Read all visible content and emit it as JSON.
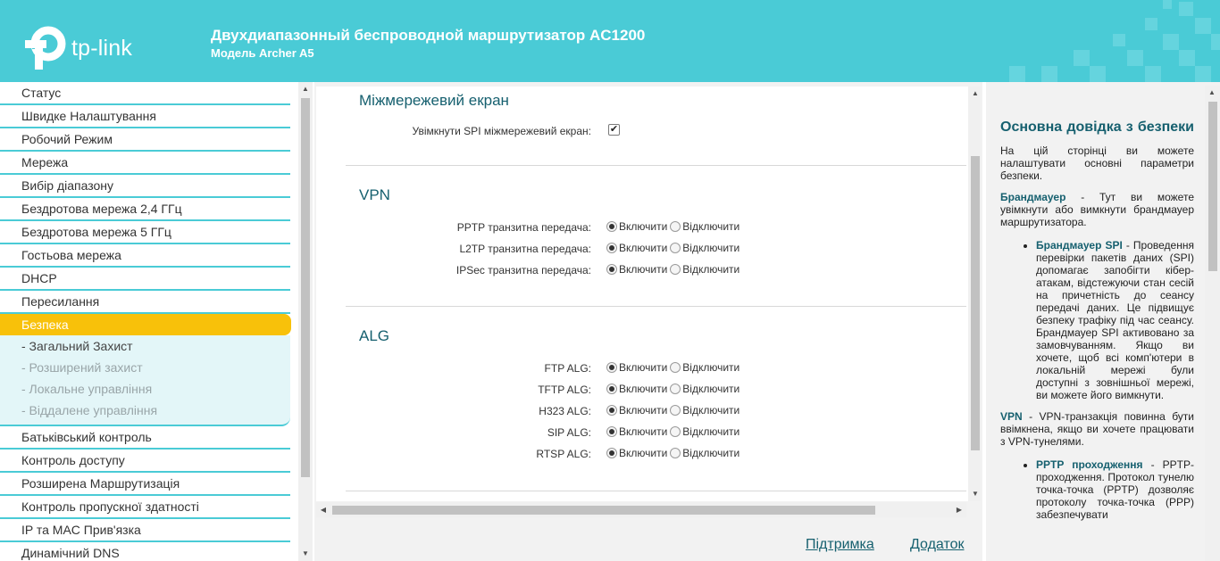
{
  "header": {
    "logo_text": "tp-link",
    "title": "Двухдиапазонный беспроводной маршрутизатор AC1200",
    "model": "Модель Archer A5"
  },
  "nav": {
    "items_top": [
      "Статус",
      "Швидке Налаштування",
      "Робочий Режим",
      "Мережа",
      "Вибір діапазону",
      "Бездротова мережа 2,4 ГГц",
      "Бездротова мережа 5 ГГц",
      "Гостьова мережа",
      "DHCP",
      "Пересилання"
    ],
    "active": "Безпека",
    "sub_items": [
      "- Загальний Захист",
      "- Розширений захист",
      "- Локальне управління",
      "- Віддалене управління"
    ],
    "items_bottom": [
      "Батьківський контроль",
      "Контроль доступу",
      "Розширена Маршрутизація",
      "Контроль пропускної здатності",
      "IP та MAC Прив'язка",
      "Динамічний DNS"
    ]
  },
  "firewall": {
    "title": "Міжмережевий екран",
    "spi_label": "Увімкнути SPI міжмережевий екран:",
    "spi_checked": true,
    "check_glyph": "✔"
  },
  "options": {
    "enable": "Включити",
    "disable": "Відключити"
  },
  "vpn": {
    "title": "VPN",
    "rows": [
      {
        "label": "PPTP транзитна передача:",
        "value": "enable"
      },
      {
        "label": "L2TP транзитна передача:",
        "value": "enable"
      },
      {
        "label": "IPSec транзитна передача:",
        "value": "enable"
      }
    ]
  },
  "alg": {
    "title": "ALG",
    "rows": [
      {
        "label": "FTP ALG:",
        "value": "enable"
      },
      {
        "label": "TFTP ALG:",
        "value": "enable"
      },
      {
        "label": "H323 ALG:",
        "value": "enable"
      },
      {
        "label": "SIP ALG:",
        "value": "enable"
      },
      {
        "label": "RTSP ALG:",
        "value": "enable"
      }
    ]
  },
  "footer": {
    "support": "Підтримка",
    "addendum": "Додаток"
  },
  "help": {
    "title": "Основна довідка з безпеки",
    "intro": "На цій сторінці ви можете налаштувати основні параметри безпеки.",
    "firewall_term": "Брандмауер",
    "firewall_text": " - Тут ви можете увімкнути або вимкнути брандмауер маршрутизатора.",
    "spi_term": "Брандмауер SPI",
    "spi_text": " - Проведення перевірки пакетів даних (SPI) допомагає запобігти кібер-атакам, відстежуючи стан сесій на причетність до сеансу передачі даних. Це підвищує безпеку трафіку під час сеансу. Брандмауер SPI активовано за замовчуванням. Якщо ви хочете, щоб всі комп'ютери в локальній мережі були доступні з зовнішньої мережі, ви можете його вимкнути.",
    "vpn_term": "VPN",
    "vpn_text": " - VPN-транзакція повинна бути ввімкнена, якщо ви хочете працювати з VPN-тунелями.",
    "pptp_term": "PPTP проходження",
    "pptp_text": " - PPTP-проходження. Протокол тунелю точка-точка (PPTP) дозволяє протоколу точка-точка (PPP) забезпечувати"
  },
  "colors": {
    "header_bg": "#4acbd6",
    "accent": "#16606f",
    "active_nav": "#f8c10a"
  }
}
